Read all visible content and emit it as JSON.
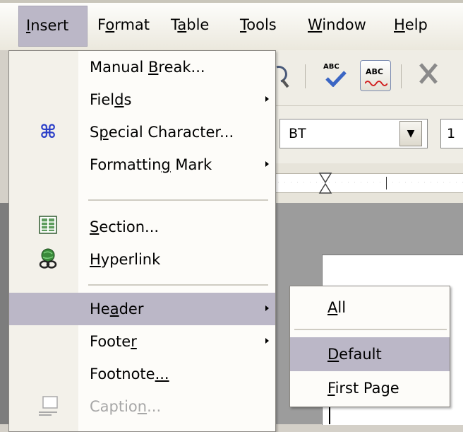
{
  "menubar": {
    "items": [
      {
        "pre": "",
        "u": "I",
        "post": "nsert"
      },
      {
        "pre": "F",
        "u": "o",
        "post": "rmat"
      },
      {
        "pre": "T",
        "u": "a",
        "post": "ble"
      },
      {
        "pre": "",
        "u": "T",
        "post": "ools"
      },
      {
        "pre": "",
        "u": "W",
        "post": "indow"
      },
      {
        "pre": "",
        "u": "H",
        "post": "elp"
      }
    ]
  },
  "toolbar": {
    "font_name": "BT",
    "font_size": "1",
    "spellcheck_label": "ABC",
    "autospell_label": "ABC"
  },
  "insert_menu": {
    "items": [
      {
        "pre": "Manual ",
        "u": "B",
        "post": "reak...",
        "submenu": false,
        "icon": ""
      },
      {
        "pre": "Fiel",
        "u": "d",
        "post": "s",
        "submenu": true,
        "icon": ""
      },
      {
        "pre": "S",
        "u": "p",
        "post": "ecial Character...",
        "submenu": false,
        "icon": "special-character-icon"
      },
      {
        "pre": "Formattin",
        "u": "g",
        "post": " Mark",
        "submenu": true,
        "icon": ""
      },
      {
        "pre": "",
        "u": "S",
        "post": "ection...",
        "submenu": false,
        "icon": "section-icon"
      },
      {
        "pre": "",
        "u": "H",
        "post": "yperlink",
        "submenu": false,
        "icon": "hyperlink-icon"
      },
      {
        "pre": "He",
        "u": "a",
        "post": "der",
        "submenu": true,
        "icon": "",
        "highlighted": true
      },
      {
        "pre": "Foote",
        "u": "r",
        "post": "",
        "submenu": true,
        "icon": ""
      },
      {
        "pre": "Footnote",
        "u": "...",
        "post": "",
        "submenu": false,
        "icon": ""
      },
      {
        "pre": "Captio",
        "u": "n",
        "post": "...",
        "submenu": false,
        "icon": "caption-icon",
        "disabled": true
      }
    ]
  },
  "header_submenu": {
    "items": [
      {
        "pre": "",
        "u": "A",
        "post": "ll"
      },
      {
        "pre": "",
        "u": "D",
        "post": "efault",
        "highlighted": true
      },
      {
        "pre": "",
        "u": "F",
        "post": "irst Page"
      }
    ]
  },
  "colors": {
    "highlight": "#bbb7c7",
    "menu_bg": "#fdfcf9",
    "disabled_text": "#a7a7a7"
  }
}
